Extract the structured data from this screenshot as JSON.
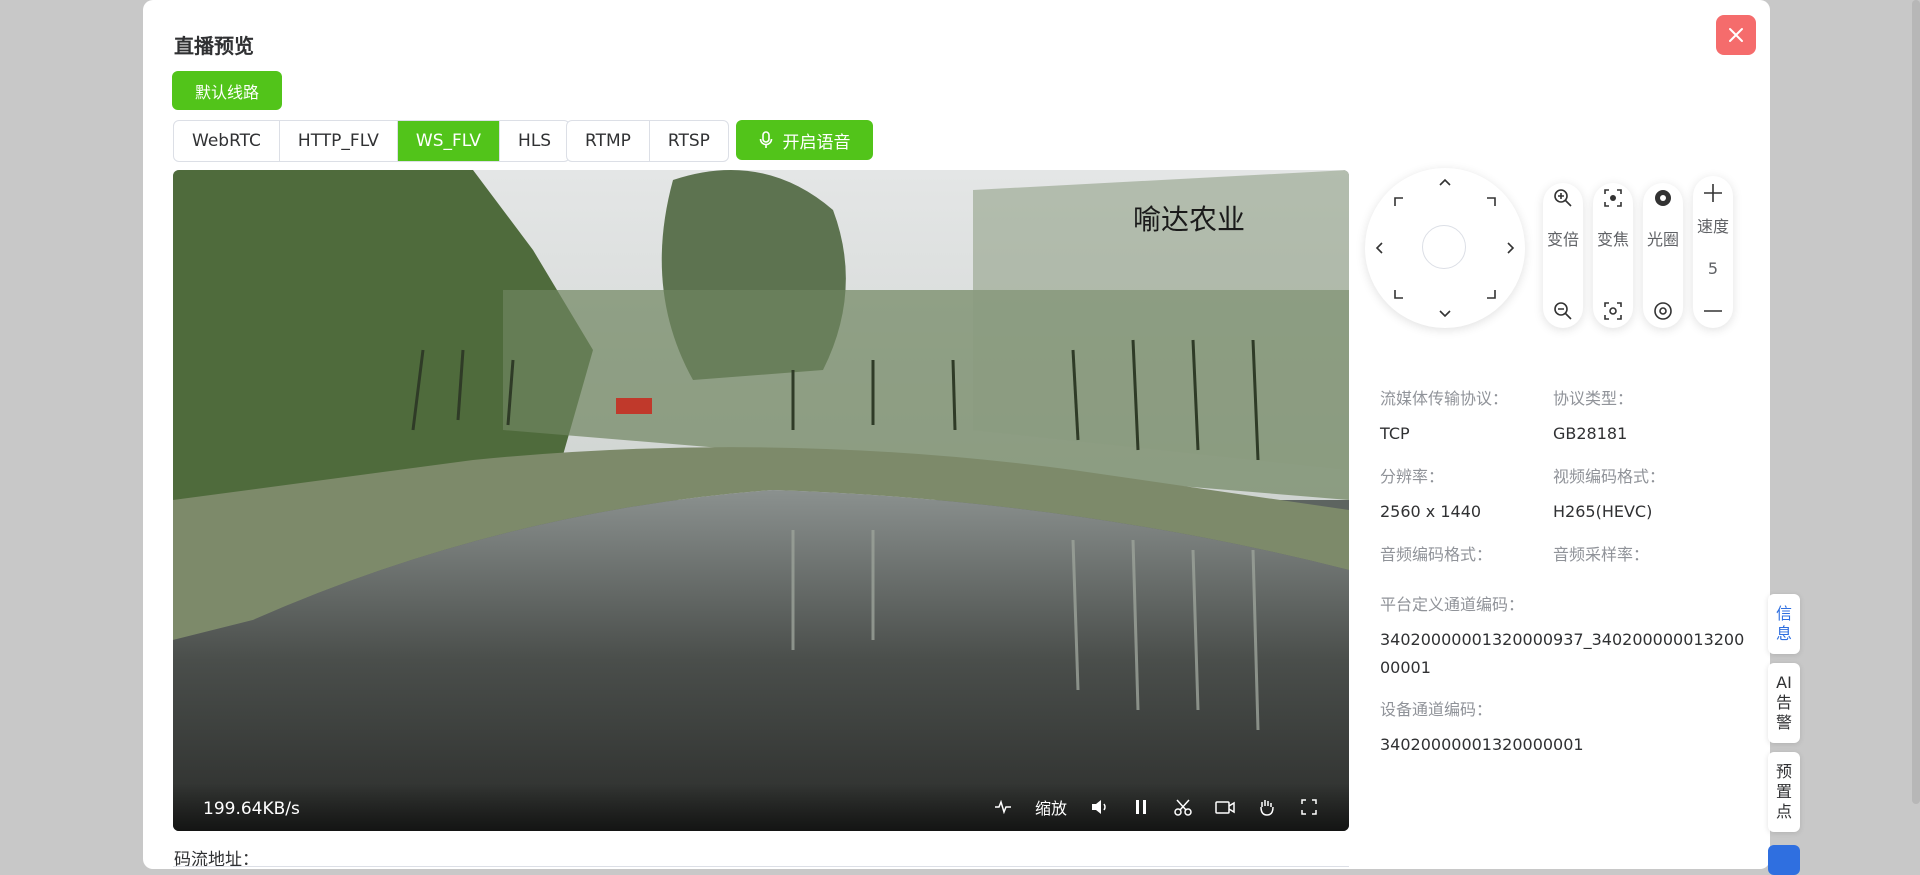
{
  "dialog": {
    "title": "直播预览",
    "route_button": "默认线路",
    "protocols": [
      "WebRTC",
      "HTTP_FLV",
      "WS_FLV",
      "HLS"
    ],
    "active_protocol": "WS_FLV",
    "pull_protocols": [
      "RTMP",
      "RTSP"
    ],
    "voice_button": "开启语音",
    "stream_address_label": "码流地址："
  },
  "player": {
    "watermark": "喻达农业",
    "bitrate": "199.64KB/s",
    "zoom_label": "缩放",
    "icons": [
      "waveform-icon",
      "volume-icon",
      "pause-icon",
      "scissors-icon",
      "record-icon",
      "hand-icon",
      "fullscreen-icon"
    ]
  },
  "ptz": {
    "zoom": {
      "label": "变倍"
    },
    "focus": {
      "label": "变焦"
    },
    "iris": {
      "label": "光圈"
    },
    "speed": {
      "label": "速度",
      "value": "5"
    }
  },
  "info": {
    "transport_key": "流媒体传输协议：",
    "transport_val": "TCP",
    "protocol_type_key": "协议类型：",
    "protocol_type_val": "GB28181",
    "resolution_key": "分辨率：",
    "resolution_val": "2560 x 1440",
    "video_codec_key": "视频编码格式：",
    "video_codec_val": "H265(HEVC)",
    "audio_codec_key": "音频编码格式：",
    "audio_rate_key": "音频采样率：",
    "platform_channel_key": "平台定义通道编码：",
    "platform_channel_val_1": "34020000001320000937_340200000013200",
    "platform_channel_val_2": "00001",
    "device_channel_key": "设备通道编码：",
    "device_channel_val": "34020000001320000001"
  },
  "side_tabs": [
    "信息",
    "AI告警",
    "预置点"
  ],
  "colors": {
    "accent_green": "#52c41a",
    "close_red": "#f56c6c",
    "accent_blue": "#2f6fe0"
  }
}
